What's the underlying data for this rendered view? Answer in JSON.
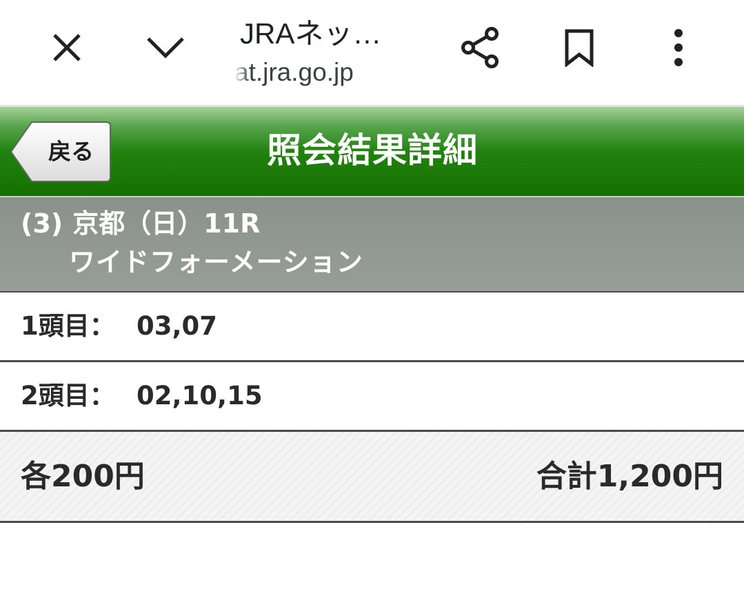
{
  "browser": {
    "page_title": "JRAネッ…",
    "url": "at.jra.go.jp",
    "icons": {
      "close": "close-icon",
      "collapse": "chevron-down-icon",
      "share": "share-icon",
      "bookmark": "bookmark-icon",
      "menu": "more-vert-icon"
    }
  },
  "header": {
    "back_label": "戻る",
    "title": "照会結果詳細",
    "accent_color": "#1a7a06"
  },
  "race": {
    "number": "(3)",
    "venue_day_race": "京都（日）11R",
    "bet_type": "ワイドフォーメーション"
  },
  "selections": [
    {
      "label": "1頭目：",
      "value": "03,07"
    },
    {
      "label": "2頭目：",
      "value": "02,10,15"
    }
  ],
  "totals": {
    "unit_price": "各200円",
    "total_price": "合計1,200円"
  }
}
